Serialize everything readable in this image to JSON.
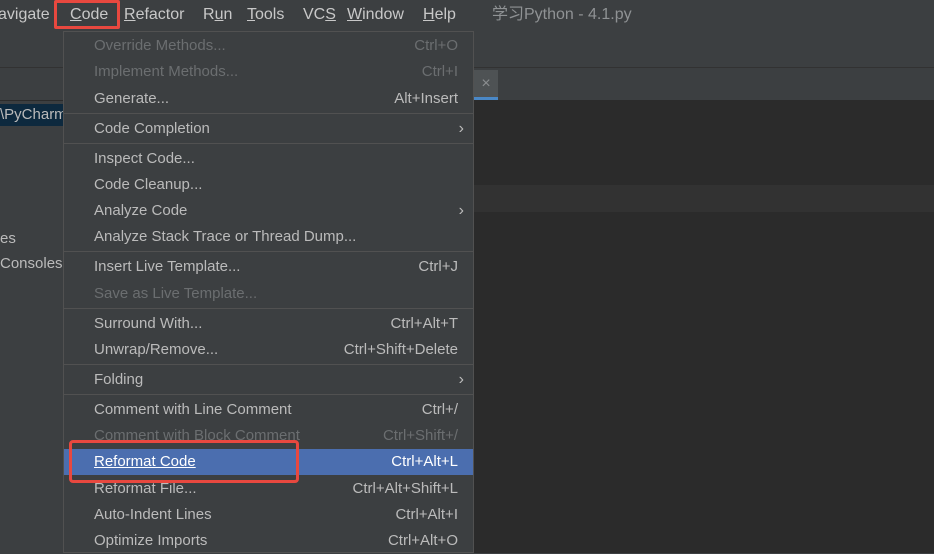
{
  "menubar": {
    "items": [
      {
        "label": "avigate",
        "underline": ""
      },
      {
        "label": "Code",
        "underline": "C"
      },
      {
        "label": "Refactor",
        "underline": "R"
      },
      {
        "label": "Run",
        "underline": "u"
      },
      {
        "label": "Tools",
        "underline": "T"
      },
      {
        "label": "VCS",
        "underline": "S"
      },
      {
        "label": "Window",
        "underline": "W"
      },
      {
        "label": "Help",
        "underline": "H"
      }
    ],
    "window_title": "学习Python - 4.1.py"
  },
  "project_tree": {
    "items": [
      "\\PyCharm",
      "es",
      "Consoles"
    ]
  },
  "editor": {
    "tab_close": "×"
  },
  "code_menu": {
    "items": [
      {
        "label": "Override Methods...",
        "shortcut": "Ctrl+O",
        "disabled": true
      },
      {
        "label": "Implement Methods...",
        "shortcut": "Ctrl+I",
        "disabled": true
      },
      {
        "label": "Generate...",
        "shortcut": "Alt+Insert"
      },
      {
        "label": "Code Completion",
        "submenu": true
      },
      {
        "label": "Inspect Code...",
        "shortcut": ""
      },
      {
        "label": "Code Cleanup...",
        "shortcut": ""
      },
      {
        "label": "Analyze Code",
        "submenu": true
      },
      {
        "label": "Analyze Stack Trace or Thread Dump...",
        "shortcut": ""
      },
      {
        "label": "Insert Live Template...",
        "shortcut": "Ctrl+J"
      },
      {
        "label": "Save as Live Template...",
        "shortcut": "",
        "disabled": true
      },
      {
        "label": "Surround With...",
        "shortcut": "Ctrl+Alt+T"
      },
      {
        "label": "Unwrap/Remove...",
        "shortcut": "Ctrl+Shift+Delete"
      },
      {
        "label": "Folding",
        "submenu": true
      },
      {
        "label": "Comment with Line Comment",
        "shortcut": "Ctrl+/"
      },
      {
        "label": "Comment with Block Comment",
        "shortcut": "Ctrl+Shift+/",
        "disabled": true
      },
      {
        "label": "Reformat Code",
        "shortcut": "Ctrl+Alt+L",
        "selected": true
      },
      {
        "label": "Reformat File...",
        "shortcut": "Ctrl+Alt+Shift+L"
      },
      {
        "label": "Auto-Indent Lines",
        "shortcut": "Ctrl+Alt+I"
      },
      {
        "label": "Optimize Imports",
        "shortcut": "Ctrl+Alt+O"
      }
    ],
    "submenu_arrow": "›"
  },
  "colors": {
    "selected": "#4b6eaf",
    "highlight_box": "#e8483f"
  }
}
